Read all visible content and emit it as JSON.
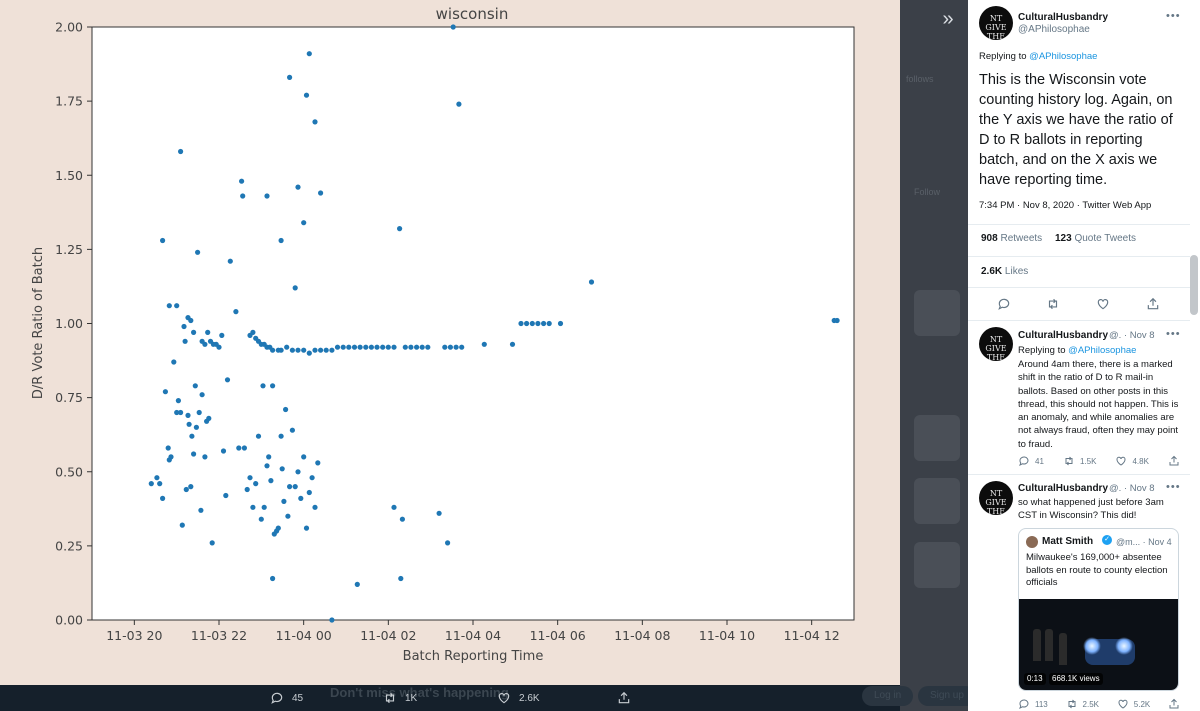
{
  "media_viewer": {
    "chart_title": "wisconsin",
    "dim_labels": [
      "Don't miss what's happening",
      "Log in",
      "Sign up",
      "Follow",
      "follows"
    ],
    "actions": [
      {
        "icon": "reply-icon",
        "count": "45"
      },
      {
        "icon": "retweet-icon",
        "count": "1K"
      },
      {
        "icon": "like-icon",
        "count": "2.6K"
      },
      {
        "icon": "share-icon",
        "count": ""
      }
    ],
    "collapse_icon": "double-chevron-right-icon"
  },
  "chart_data": {
    "type": "scatter",
    "title": "wisconsin",
    "xlabel": "Batch Reporting Time",
    "ylabel": "D/R Vote Ratio of Batch",
    "x_ticks": [
      "11-03 20",
      "11-03 22",
      "11-04 00",
      "11-04 02",
      "11-04 04",
      "11-04 06",
      "11-04 08",
      "11-04 10",
      "11-04 12"
    ],
    "x_unit": "hours after 11-03 20:00",
    "xlim": [
      -0.75,
      12.75
    ],
    "y_ticks": [
      "0.00",
      "0.25",
      "0.50",
      "0.75",
      "1.00",
      "1.25",
      "1.50",
      "1.75",
      "2.00"
    ],
    "ylim": [
      0,
      2
    ],
    "grid": false,
    "point_color": "#1f77b4",
    "points": [
      [
        0.3,
        0.46
      ],
      [
        0.4,
        0.48
      ],
      [
        0.45,
        0.46
      ],
      [
        0.5,
        0.41
      ],
      [
        0.55,
        0.77
      ],
      [
        0.6,
        0.58
      ],
      [
        0.62,
        0.54
      ],
      [
        0.65,
        0.55
      ],
      [
        0.7,
        0.87
      ],
      [
        0.75,
        0.7
      ],
      [
        0.78,
        0.74
      ],
      [
        0.82,
        0.7
      ],
      [
        0.85,
        0.32
      ],
      [
        0.9,
        0.94
      ],
      [
        0.92,
        0.44
      ],
      [
        0.95,
        0.69
      ],
      [
        0.97,
        0.66
      ],
      [
        1.0,
        0.45
      ],
      [
        1.02,
        0.62
      ],
      [
        1.05,
        0.56
      ],
      [
        1.08,
        0.79
      ],
      [
        1.1,
        0.65
      ],
      [
        1.15,
        0.7
      ],
      [
        1.18,
        0.37
      ],
      [
        1.2,
        0.76
      ],
      [
        1.25,
        0.55
      ],
      [
        1.28,
        0.67
      ],
      [
        1.32,
        0.68
      ],
      [
        1.38,
        0.26
      ],
      [
        1.2,
        0.94
      ],
      [
        1.25,
        0.93
      ],
      [
        1.3,
        0.97
      ],
      [
        1.35,
        0.94
      ],
      [
        1.4,
        0.93
      ],
      [
        1.45,
        0.93
      ],
      [
        1.5,
        0.92
      ],
      [
        1.58,
        0.57
      ],
      [
        1.62,
        0.42
      ],
      [
        1.65,
        0.81
      ],
      [
        1.55,
        0.96
      ],
      [
        0.5,
        1.28
      ],
      [
        0.62,
        1.06
      ],
      [
        0.75,
        1.06
      ],
      [
        0.82,
        1.58
      ],
      [
        0.88,
        0.99
      ],
      [
        0.95,
        1.02
      ],
      [
        1.0,
        1.01
      ],
      [
        1.05,
        0.97
      ],
      [
        1.12,
        1.24
      ],
      [
        1.7,
        1.21
      ],
      [
        1.8,
        1.04
      ],
      [
        1.85,
        0.58
      ],
      [
        1.9,
        1.48
      ],
      [
        1.92,
        1.43
      ],
      [
        1.95,
        0.58
      ],
      [
        2.0,
        0.44
      ],
      [
        2.05,
        0.48
      ],
      [
        2.1,
        0.38
      ],
      [
        2.15,
        0.46
      ],
      [
        2.2,
        0.62
      ],
      [
        2.25,
        0.34
      ],
      [
        2.28,
        0.79
      ],
      [
        2.3,
        0.38
      ],
      [
        2.35,
        0.52
      ],
      [
        2.38,
        0.55
      ],
      [
        2.42,
        0.47
      ],
      [
        2.45,
        0.79
      ],
      [
        2.48,
        0.29
      ],
      [
        2.52,
        0.3
      ],
      [
        2.55,
        0.31
      ],
      [
        2.6,
        0.62
      ],
      [
        2.62,
        0.51
      ],
      [
        2.65,
        0.4
      ],
      [
        2.68,
        0.71
      ],
      [
        2.72,
        0.35
      ],
      [
        2.75,
        0.45
      ],
      [
        2.8,
        0.64
      ],
      [
        2.85,
        0.45
      ],
      [
        2.9,
        0.5
      ],
      [
        2.95,
        0.41
      ],
      [
        3.0,
        0.55
      ],
      [
        3.05,
        0.31
      ],
      [
        3.1,
        0.43
      ],
      [
        3.15,
        0.48
      ],
      [
        3.2,
        0.38
      ],
      [
        3.25,
        0.53
      ],
      [
        2.35,
        1.43
      ],
      [
        2.45,
        0.14
      ],
      [
        2.6,
        1.28
      ],
      [
        2.75,
        1.83
      ],
      [
        2.85,
        1.12
      ],
      [
        2.9,
        1.46
      ],
      [
        3.0,
        1.34
      ],
      [
        3.05,
        1.77
      ],
      [
        3.1,
        1.91
      ],
      [
        3.2,
        1.68
      ],
      [
        3.3,
        1.44
      ],
      [
        3.5,
        0.0
      ],
      [
        2.05,
        0.96
      ],
      [
        2.1,
        0.97
      ],
      [
        2.15,
        0.95
      ],
      [
        2.2,
        0.94
      ],
      [
        2.25,
        0.93
      ],
      [
        2.3,
        0.93
      ],
      [
        2.35,
        0.92
      ],
      [
        2.4,
        0.92
      ],
      [
        2.45,
        0.91
      ],
      [
        2.55,
        0.91
      ],
      [
        2.6,
        0.91
      ],
      [
        2.7,
        0.92
      ],
      [
        2.8,
        0.91
      ],
      [
        2.9,
        0.91
      ],
      [
        3.0,
        0.91
      ],
      [
        3.1,
        0.9
      ],
      [
        3.2,
        0.91
      ],
      [
        3.3,
        0.91
      ],
      [
        3.4,
        0.91
      ],
      [
        3.5,
        0.91
      ],
      [
        3.6,
        0.92
      ],
      [
        3.7,
        0.92
      ],
      [
        3.8,
        0.92
      ],
      [
        3.9,
        0.92
      ],
      [
        4.0,
        0.92
      ],
      [
        4.1,
        0.92
      ],
      [
        4.2,
        0.92
      ],
      [
        4.3,
        0.92
      ],
      [
        4.4,
        0.92
      ],
      [
        4.5,
        0.92
      ],
      [
        4.6,
        0.92
      ],
      [
        4.8,
        0.92
      ],
      [
        4.9,
        0.92
      ],
      [
        5.0,
        0.92
      ],
      [
        5.1,
        0.92
      ],
      [
        5.2,
        0.92
      ],
      [
        5.5,
        0.92
      ],
      [
        5.6,
        0.92
      ],
      [
        5.7,
        0.92
      ],
      [
        5.8,
        0.92
      ],
      [
        6.2,
        0.93
      ],
      [
        6.7,
        0.93
      ],
      [
        3.95,
        0.12
      ],
      [
        4.6,
        0.38
      ],
      [
        4.75,
        0.34
      ],
      [
        4.7,
        1.32
      ],
      [
        4.72,
        0.14
      ],
      [
        5.4,
        0.36
      ],
      [
        5.55,
        0.26
      ],
      [
        5.65,
        2.0
      ],
      [
        5.75,
        1.74
      ],
      [
        6.85,
        1.0
      ],
      [
        6.95,
        1.0
      ],
      [
        7.05,
        1.0
      ],
      [
        7.15,
        1.0
      ],
      [
        7.25,
        1.0
      ],
      [
        7.35,
        1.0
      ],
      [
        7.55,
        1.0
      ],
      [
        8.1,
        1.14
      ],
      [
        12.4,
        1.01
      ],
      [
        12.45,
        1.01
      ]
    ]
  },
  "panel": {
    "main_tweet": {
      "avatar_text": "NT GIVE THE SHIP",
      "name": "CulturalHusbandry",
      "handle": "@APhilosophae",
      "replying_to_label": "Replying to",
      "replying_to": "@APhilosophae",
      "text": "This is the Wisconsin vote counting history log. Again, on the Y axis we have the ratio of D to R ballots in reporting batch, and on the X axis we have reporting time.",
      "timestamp": "7:34 PM · Nov 8, 2020 · Twitter Web App",
      "retweets": "908",
      "retweets_label": "Retweets",
      "quotes": "123",
      "quotes_label": "Quote Tweets",
      "likes": "2.6K",
      "likes_label": "Likes"
    },
    "reply1": {
      "avatar_text": "NT GIVE THE SHIP",
      "name": "CulturalHusbandry",
      "handle": "@. · Nov 8",
      "replying_to_label": "Replying to",
      "replying_to": "@APhilosophae",
      "text": "Around 4am there, there is a marked shift in the ratio of D to R mail-in ballots. Based on other posts in this thread, this should not happen. This is an anomaly, and while anomalies are not always fraud, often they may point to fraud.",
      "replies": "41",
      "retweets": "1.5K",
      "likes": "4.8K"
    },
    "reply2": {
      "avatar_text": "NT GIVE THE SHIP",
      "name": "CulturalHusbandry",
      "handle": "@. · Nov 8",
      "text": "so what happened just before 3am CST in Wisconsin? This did!",
      "quote": {
        "name": "Matt Smith",
        "handle": "@m... · Nov 4",
        "text": "Milwaukee's 169,000+ absentee ballots en route to county election officials",
        "video_time": "0:13",
        "views": "668.1K views"
      },
      "replies": "113",
      "retweets": "2.5K",
      "likes": "5.2K"
    }
  }
}
